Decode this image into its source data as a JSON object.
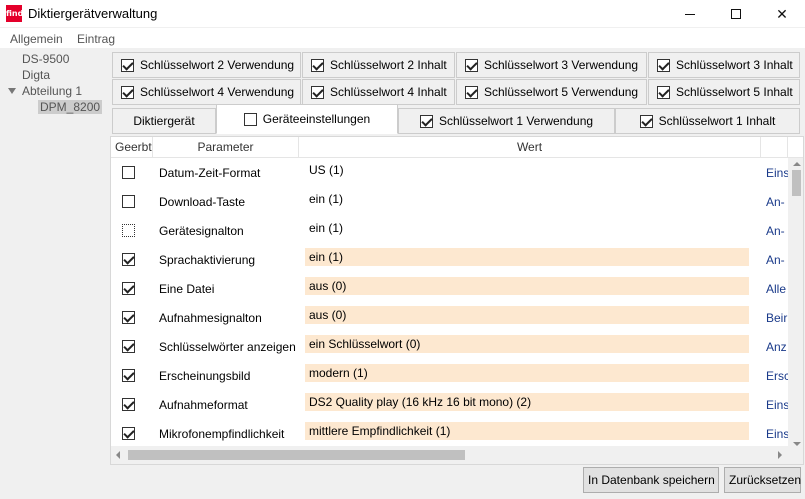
{
  "window": {
    "title": "Diktiergerätverwaltung",
    "icon_text": "find",
    "minimize": "—",
    "maximize": "☐",
    "close": "✕"
  },
  "menu": {
    "items": [
      "Allgemein",
      "Eintrag"
    ]
  },
  "tree": {
    "items": [
      {
        "label": "DS-9500"
      },
      {
        "label": "Digta"
      },
      {
        "label": "Abteilung 1",
        "expanded": true
      },
      {
        "label": "DPM_8200",
        "selected": true
      }
    ]
  },
  "tabs": {
    "row1": [
      {
        "label": "Schlüsselwort 2 Verwendung",
        "checked": true
      },
      {
        "label": "Schlüsselwort 2 Inhalt",
        "checked": true
      },
      {
        "label": "Schlüsselwort 3 Verwendung",
        "checked": true
      },
      {
        "label": "Schlüsselwort 3 Inhalt",
        "checked": true
      }
    ],
    "row2": [
      {
        "label": "Schlüsselwort 4 Verwendung",
        "checked": true
      },
      {
        "label": "Schlüsselwort 4 Inhalt",
        "checked": true
      },
      {
        "label": "Schlüsselwort 5 Verwendung",
        "checked": true
      },
      {
        "label": "Schlüsselwort 5 Inhalt",
        "checked": true
      }
    ],
    "row3": [
      {
        "label": "Diktiergerät",
        "checked": null
      },
      {
        "label": "Geräteeinstellungen",
        "checked": false,
        "active": true
      },
      {
        "label": "Schlüsselwort 1 Verwendung",
        "checked": true
      },
      {
        "label": "Schlüsselwort 1 Inhalt",
        "checked": true
      }
    ]
  },
  "grid": {
    "headers": {
      "inherited": "Geerbt",
      "parameter": "Parameter",
      "value": "Wert"
    },
    "rows": [
      {
        "inherited": "unchecked",
        "parameter": "Datum-Zeit-Format",
        "value": "US (1)",
        "changed": false,
        "extra": "Eins"
      },
      {
        "inherited": "unchecked",
        "parameter": "Download-Taste",
        "value": "ein (1)",
        "changed": false,
        "extra": "An-"
      },
      {
        "inherited": "focus",
        "parameter": "Gerätesignalton",
        "value": "ein (1)",
        "changed": false,
        "extra": "An-"
      },
      {
        "inherited": "checked",
        "parameter": "Sprachaktivierung",
        "value": "ein (1)",
        "changed": true,
        "extra": "An-"
      },
      {
        "inherited": "checked",
        "parameter": "Eine Datei",
        "value": "aus (0)",
        "changed": true,
        "extra": "Alle"
      },
      {
        "inherited": "checked",
        "parameter": "Aufnahmesignalton",
        "value": "aus (0)",
        "changed": true,
        "extra": "Beir"
      },
      {
        "inherited": "checked",
        "parameter": "Schlüsselwörter anzeigen",
        "value": "ein Schlüsselwort (0)",
        "changed": true,
        "extra": "Anz"
      },
      {
        "inherited": "checked",
        "parameter": "Erscheinungsbild",
        "value": "modern (1)",
        "changed": true,
        "extra": "Ersc"
      },
      {
        "inherited": "checked",
        "parameter": "Aufnahmeformat",
        "value": "DS2 Quality play (16 kHz 16 bit mono) (2)",
        "changed": true,
        "extra": "Eins"
      },
      {
        "inherited": "checked",
        "parameter": "Mikrofonempfindlichkeit",
        "value": "mittlere Empfindlichkeit (1)",
        "changed": true,
        "extra": "Eins"
      }
    ]
  },
  "buttons": {
    "save": "In Datenbank speichern",
    "reset": "Zurücksetzen"
  },
  "colors": {
    "accent": "#e4002b",
    "changed_value_bg": "#fde8d0",
    "extra_text": "#1a3a8a"
  }
}
